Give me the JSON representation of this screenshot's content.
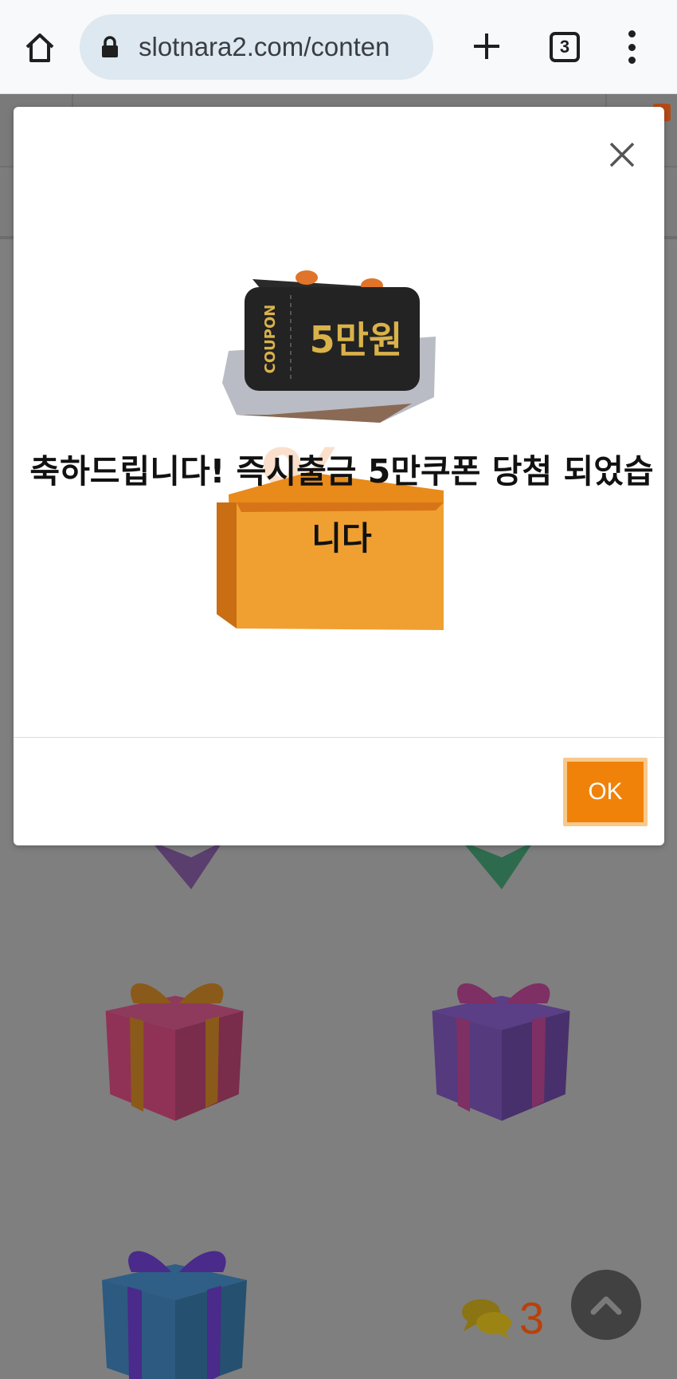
{
  "browser": {
    "url": "slotnara2.com/conten",
    "tab_count": "3",
    "icons": [
      "home-icon",
      "lock-icon",
      "new-tab-icon",
      "tab-switcher-icon",
      "more-menu-icon"
    ]
  },
  "modal": {
    "message": "축하드립니다! 즉시출금 5만쿠폰 당첨 되었습니다",
    "ok_label": "OK",
    "coupon": {
      "side_label": "COUPON",
      "amount_label": "5만원"
    }
  },
  "chat": {
    "count": "3"
  },
  "colors": {
    "accent": "#f0820a",
    "overlay": "#7f7f7f",
    "coupon_gold": "#d9b24a",
    "chat_count": "#b8410b"
  }
}
